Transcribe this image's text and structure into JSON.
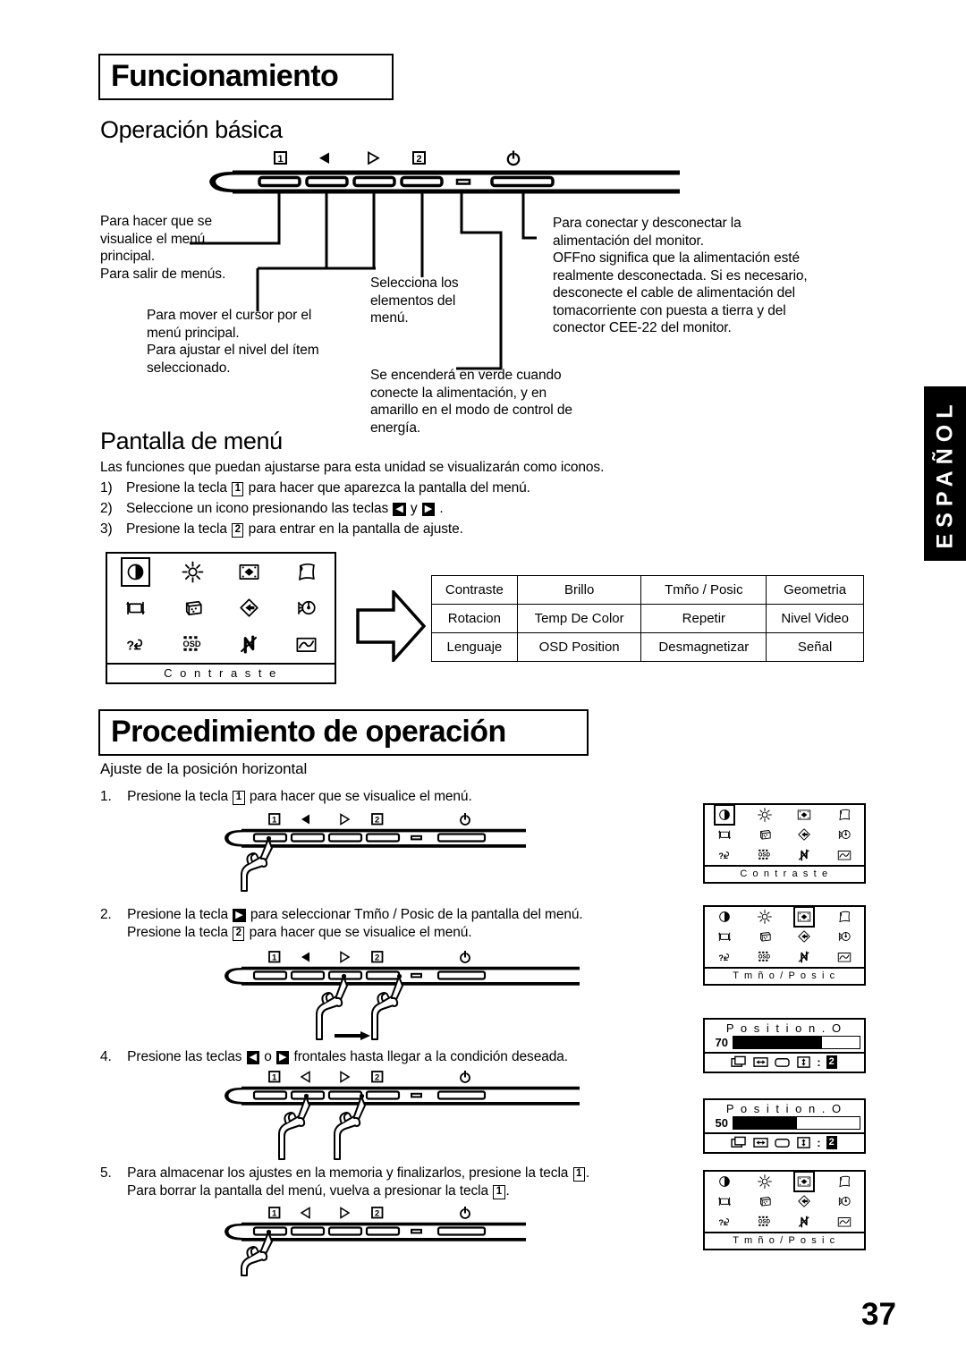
{
  "page": {
    "number": "37",
    "side_tab": "ESPAÑOL"
  },
  "section_operation": {
    "banner_title": "Funcionamiento",
    "subheading": "Operación básica",
    "bezel_labels": [
      "1",
      "◁",
      "▷",
      "2",
      "power"
    ],
    "callouts": {
      "key1": [
        "Para hacer que se",
        "visualice el menú",
        "principal.",
        "Para salir de menús."
      ],
      "arrows": [
        "Para mover el cursor por el",
        "menú principal.",
        "Para ajustar el nivel del ítem",
        "seleccionado."
      ],
      "key2": [
        "Selecciona los",
        "elementos del",
        "menú."
      ],
      "power": [
        "Para conectar y desconectar la",
        "alimentación del monitor.",
        "OFFno significa que la alimentación esté",
        "realmente desconectada. Si es necesario,",
        "desconecte el cable de alimentación del",
        "tomacorriente con puesta a tierra y del",
        "conector CEE-22 del monitor."
      ],
      "led": [
        "Se encenderá en verde cuando",
        "conecte la alimentación, y en",
        "amarillo en el modo de control de",
        "energía."
      ]
    }
  },
  "section_menu_screen": {
    "subheading": "Pantalla de menú",
    "intro": "Las funciones que puedan ajustarse para esta unidad se visualizarán como iconos.",
    "steps": [
      {
        "num": "1)",
        "before": "Presione la tecla",
        "key": "1",
        "key_style": "box",
        "after": "para hacer que aparezca la pantalla del menú."
      },
      {
        "num": "2)",
        "before": "Seleccione un icono presionando las teclas",
        "key": "◀",
        "key2": "▶",
        "mid": "y",
        "key_style": "fill",
        "after": "."
      },
      {
        "num": "3)",
        "before": "Presione la tecla",
        "key": "2",
        "key_style": "box",
        "after": "para entrar en la pantalla de ajuste."
      }
    ],
    "osd_panel": {
      "caption": "C o n t r a s t e",
      "icons": [
        "contrast-icon",
        "brightness-icon",
        "size-position-icon",
        "geometry-icon",
        "rotation-icon",
        "color-temp-icon",
        "recall-icon",
        "degauss-icon",
        "language-icon",
        "osd-position-icon",
        "moire-icon",
        "signal-icon"
      ],
      "selected_index": 0
    },
    "menu_table": {
      "rows": [
        [
          "Contraste",
          "Brillo",
          "Tmño / Posic",
          "Geometria"
        ],
        [
          "Rotacion",
          "Temp De Color",
          "Repetir",
          "Nivel Video"
        ],
        [
          "Lenguaje",
          "OSD Position",
          "Desmagnetizar",
          "Señal"
        ]
      ]
    }
  },
  "section_procedure": {
    "banner_title": "Procedimiento de operación",
    "subheading": "Ajuste de la posición horizontal",
    "steps": [
      {
        "num": "1.",
        "lines": [
          {
            "parts": [
              {
                "t": "text",
                "v": "Presione la tecla"
              },
              {
                "t": "key-box",
                "v": "1"
              },
              {
                "t": "text",
                "v": "para hacer que se visualice el menú."
              }
            ]
          }
        ]
      },
      {
        "num": "2.",
        "lines": [
          {
            "parts": [
              {
                "t": "text",
                "v": "Presione la tecla"
              },
              {
                "t": "key-fill",
                "v": "▶"
              },
              {
                "t": "text",
                "v": "para seleccionar Tmño / Posic de la pantalla del menú."
              }
            ]
          },
          {
            "parts": [
              {
                "t": "text",
                "v": "Presione la tecla"
              },
              {
                "t": "key-box",
                "v": "2"
              },
              {
                "t": "text",
                "v": "para hacer que se visualice el menú."
              }
            ]
          }
        ]
      },
      {
        "num": "4.",
        "lines": [
          {
            "parts": [
              {
                "t": "text",
                "v": "Presione las teclas"
              },
              {
                "t": "key-fill",
                "v": "◀"
              },
              {
                "t": "text",
                "v": "o"
              },
              {
                "t": "key-fill",
                "v": "▶"
              },
              {
                "t": "text",
                "v": "frontales hasta llegar a la condición deseada."
              }
            ]
          }
        ]
      },
      {
        "num": "5.",
        "lines": [
          {
            "parts": [
              {
                "t": "text",
                "v": "Para almacenar los ajustes en la memoria y finalizarlos, presione la tecla"
              },
              {
                "t": "key-box",
                "v": "1"
              },
              {
                "t": "text",
                "v": "."
              }
            ]
          },
          {
            "parts": [
              {
                "t": "text",
                "v": "Para borrar la  pantalla del menú, vuelva a presionar la tecla"
              },
              {
                "t": "key-box",
                "v": "1"
              },
              {
                "t": "text",
                "v": "."
              }
            ]
          }
        ]
      }
    ],
    "osd_panels": [
      {
        "caption": "C o n t r a s t e",
        "selected_index": 0
      },
      {
        "caption": "T m ñ o / P o s i c",
        "selected_index": 2
      },
      {
        "caption": "T m ñ o / P o s i c",
        "selected_index": 2
      }
    ],
    "slider_panels": [
      {
        "title": "P o s i t i o n . O",
        "value": "70",
        "percent": 70,
        "footer_key": "2"
      },
      {
        "title": "P o s i t i o n . O",
        "value": "50",
        "percent": 50,
        "footer_key": "2"
      }
    ]
  }
}
